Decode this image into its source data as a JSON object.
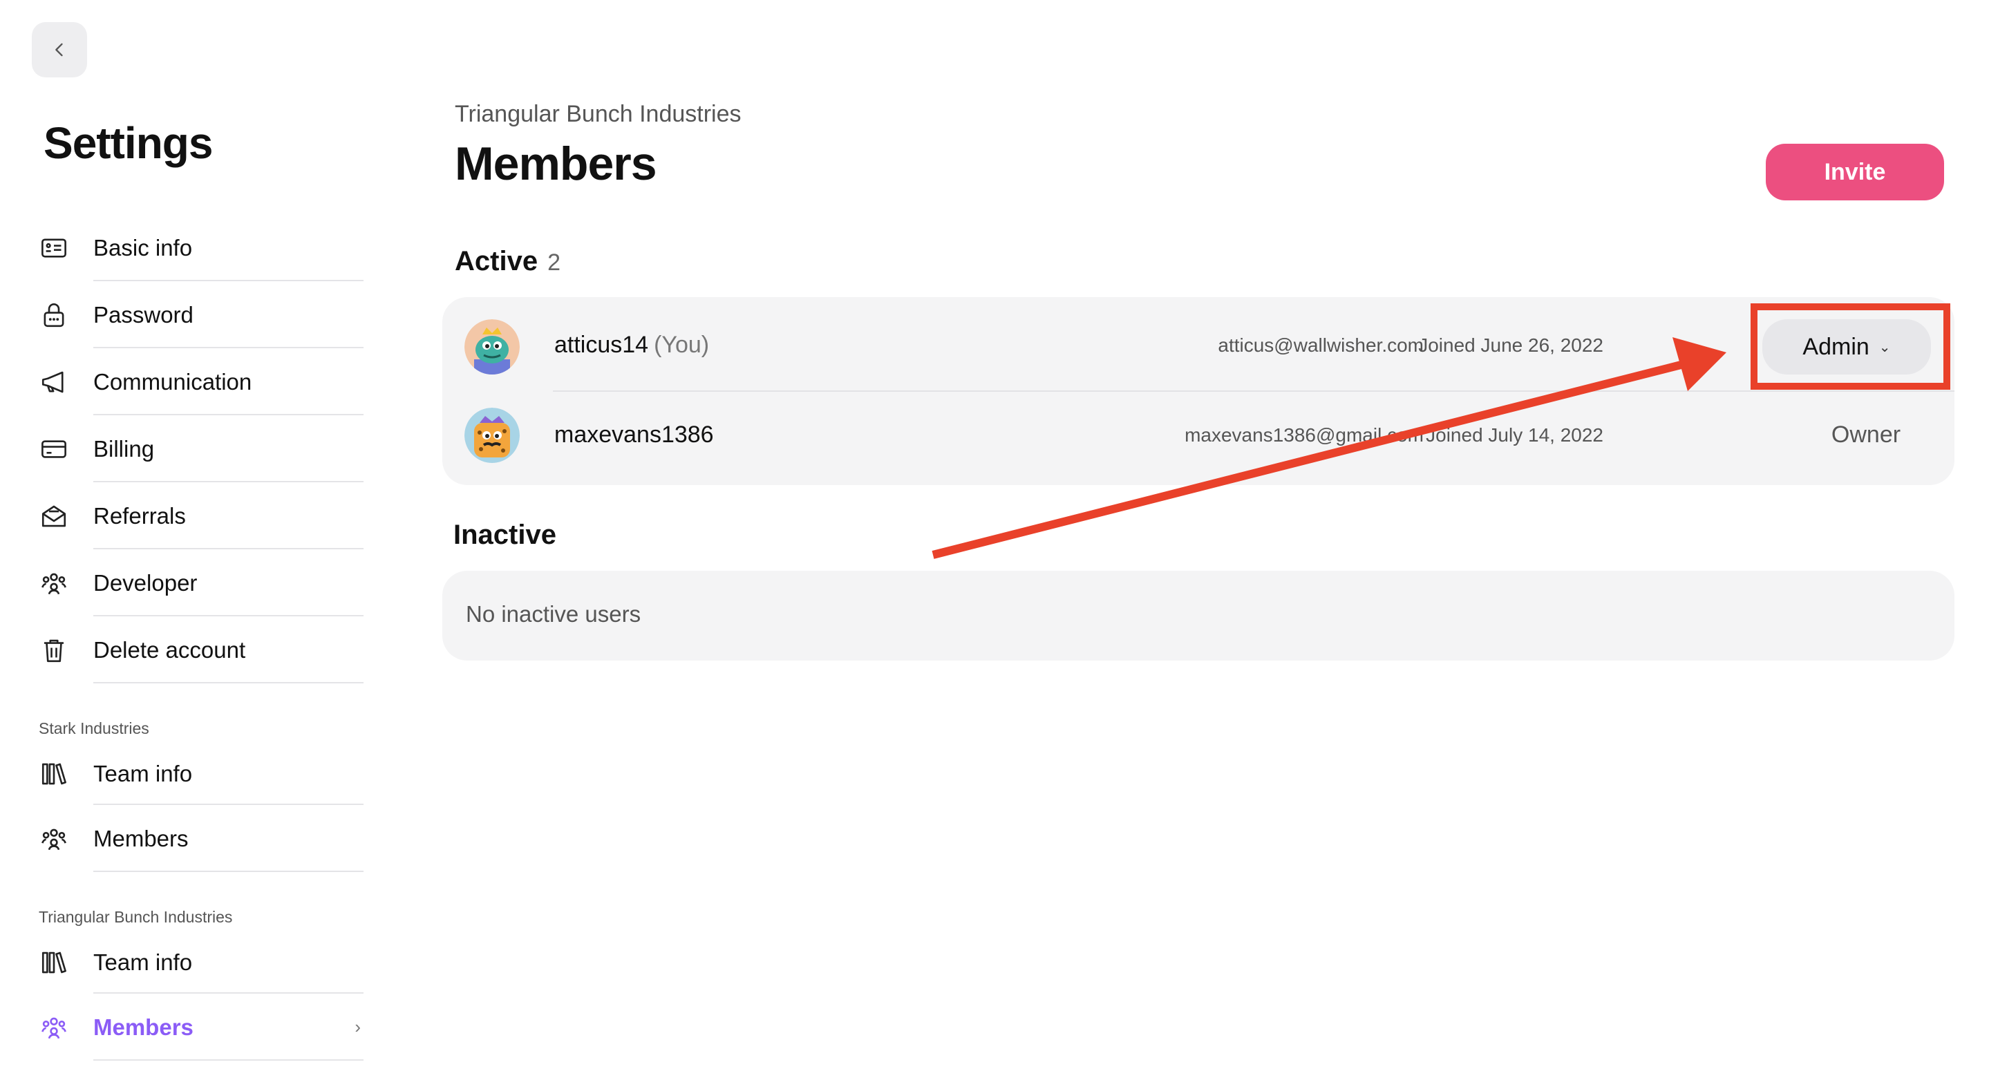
{
  "settings": {
    "title": "Settings"
  },
  "sidebar": {
    "personal_items": [
      {
        "label": "Basic info",
        "icon": "id-card-icon"
      },
      {
        "label": "Password",
        "icon": "lock-icon"
      },
      {
        "label": "Communication",
        "icon": "megaphone-icon"
      },
      {
        "label": "Billing",
        "icon": "credit-card-icon"
      },
      {
        "label": "Referrals",
        "icon": "envelope-open-icon"
      },
      {
        "label": "Developer",
        "icon": "people-icon"
      },
      {
        "label": "Delete account",
        "icon": "trash-icon"
      }
    ],
    "groups": [
      {
        "label": "Stark Industries",
        "items": [
          {
            "label": "Team info",
            "icon": "books-icon"
          },
          {
            "label": "Members",
            "icon": "people-icon"
          }
        ]
      },
      {
        "label": "Triangular Bunch Industries",
        "items": [
          {
            "label": "Team info",
            "icon": "books-icon"
          },
          {
            "label": "Members",
            "icon": "people-icon",
            "active": true
          }
        ]
      }
    ],
    "active_color": "#8b5cf6"
  },
  "main": {
    "org_name": "Triangular Bunch Industries",
    "title": "Members",
    "invite_label": "Invite",
    "invite_color": "#ec4f80",
    "active_section": {
      "title": "Active",
      "count": "2"
    },
    "members": [
      {
        "name": "atticus14",
        "you": "(You)",
        "email": "atticus@wallwisher.com",
        "joined": "Joined June 26, 2022",
        "role": "Admin",
        "role_editable": true
      },
      {
        "name": "maxevans1386",
        "you": "",
        "email": "maxevans1386@gmail.com",
        "joined": "Joined July 14, 2022",
        "role": "Owner",
        "role_editable": false
      }
    ],
    "inactive_section": {
      "title": "Inactive",
      "empty_text": "No inactive users"
    }
  },
  "annotation": {
    "color": "#e9412a"
  }
}
